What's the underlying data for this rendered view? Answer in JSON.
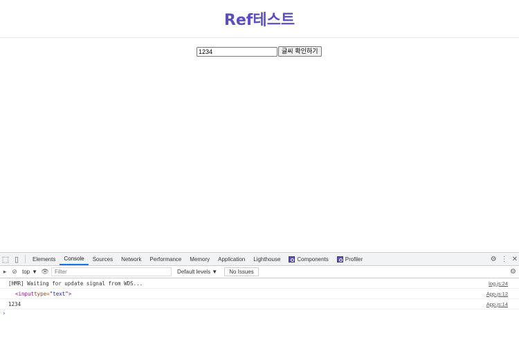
{
  "header": {
    "title": "Ref테스트"
  },
  "form": {
    "input_value": "1234",
    "button_label": "글씨 확인하기"
  },
  "devtools": {
    "tabs": [
      "Elements",
      "Console",
      "Sources",
      "Network",
      "Performance",
      "Memory",
      "Application",
      "Lighthouse",
      "Components",
      "Profiler"
    ],
    "toolbar": {
      "context": "top",
      "filter_placeholder": "Filter",
      "levels": "Default levels ▼",
      "issues": "No Issues"
    },
    "console": [
      {
        "text": "[HMR] Waiting for update signal from WDS...",
        "source": "log.js:24"
      },
      {
        "tag_open": "<input ",
        "attr": "type=",
        "val": "\"text\"",
        "tag_close": ">",
        "source": "App.js:12"
      },
      {
        "text": "1234",
        "source": "App.js:14"
      }
    ],
    "prompt": "›"
  }
}
